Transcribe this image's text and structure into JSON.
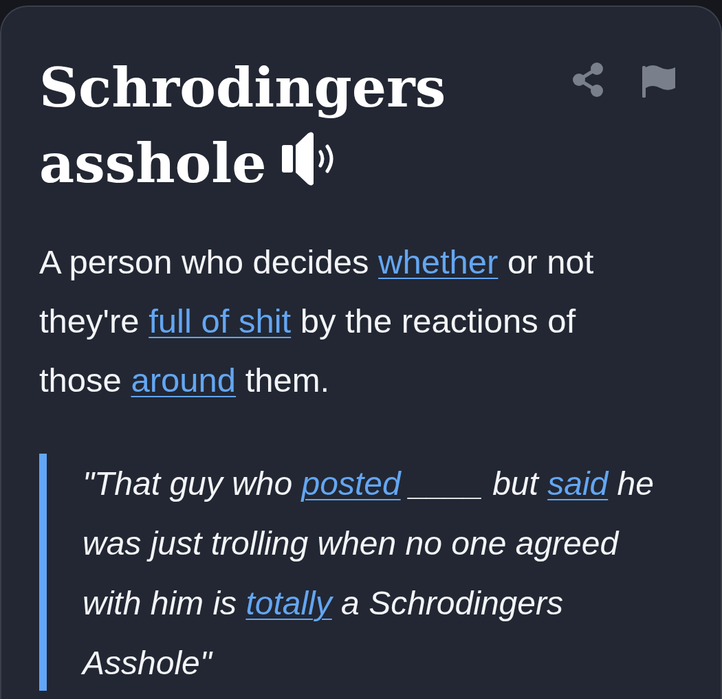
{
  "entry": {
    "title_lines": [
      "Schrodingers",
      "asshole"
    ]
  },
  "definition": [
    {
      "kind": "text",
      "text": "A person who decides "
    },
    {
      "kind": "link",
      "text": "whether"
    },
    {
      "kind": "text",
      "text": " or not they're "
    },
    {
      "kind": "link",
      "text": "full of shit"
    },
    {
      "kind": "text",
      "text": " by the reactions of those "
    },
    {
      "kind": "link",
      "text": "around"
    },
    {
      "kind": "text",
      "text": " them."
    }
  ],
  "example": [
    {
      "kind": "text",
      "text": "\"That guy who "
    },
    {
      "kind": "link",
      "text": "posted"
    },
    {
      "kind": "text",
      "text": " ____ but "
    },
    {
      "kind": "link",
      "text": "said"
    },
    {
      "kind": "text",
      "text": " he was just trolling when no one agreed with him is "
    },
    {
      "kind": "link",
      "text": "totally"
    },
    {
      "kind": "text",
      "text": " a Schrodingers Asshole\""
    }
  ]
}
